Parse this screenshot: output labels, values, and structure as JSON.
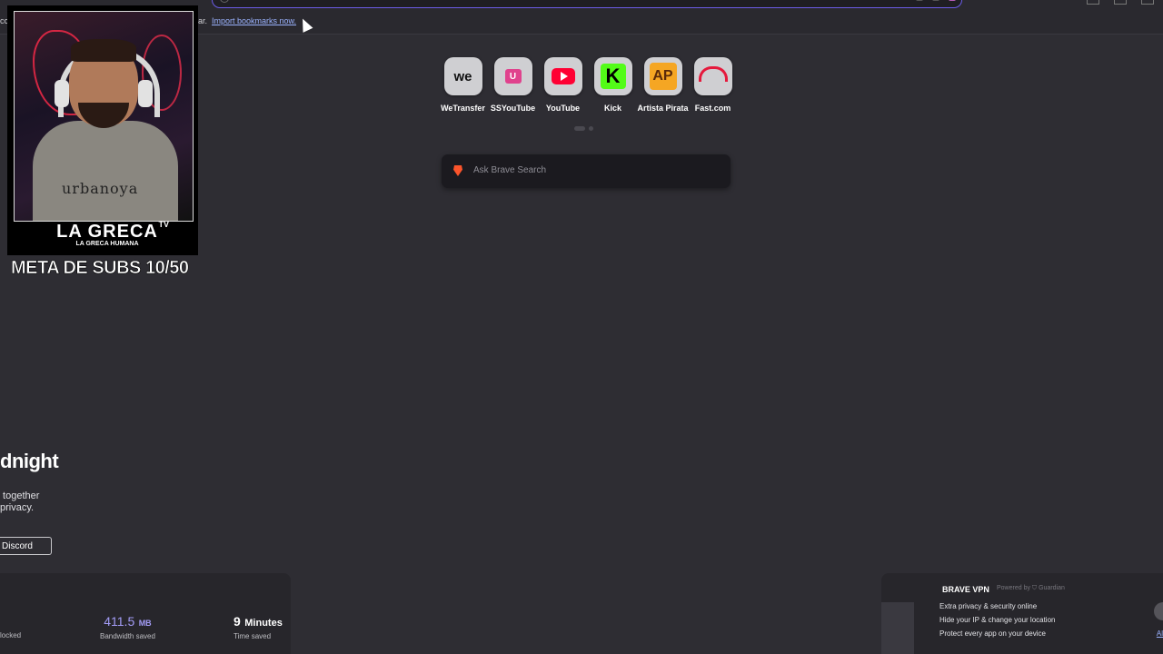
{
  "bookmarks_bar": {
    "left_fragment": "cc",
    "text_fragment": "ar.",
    "import_link": "Import bookmarks now."
  },
  "webcam_overlay": {
    "brand": "LA GRECA",
    "brand_tv": "TV",
    "brand_sub": "LA GRECA HUMANA",
    "shirt_text": "urbanoya",
    "subs_goal": "META DE SUBS 10/50"
  },
  "shortcuts": [
    {
      "label": "WeTransfer",
      "icon": "wetransfer-icon"
    },
    {
      "label": "SSYouTube",
      "icon": "ssyoutube-icon"
    },
    {
      "label": "YouTube",
      "icon": "youtube-icon"
    },
    {
      "label": "Kick",
      "icon": "kick-icon"
    },
    {
      "label": "Artista Pirata",
      "icon": "artista-pirata-icon"
    },
    {
      "label": "Fast.com",
      "icon": "fast-icon"
    }
  ],
  "shortcut_glyphs": {
    "wetransfer": "we",
    "ssyoutube": "U",
    "kick": "K",
    "artista_pirata": "AP"
  },
  "search": {
    "placeholder": "Ask Brave Search"
  },
  "promo_card": {
    "title_fragment": "dnight",
    "desc_fragment": " together\nprivacy.",
    "button_label": "Discord"
  },
  "stats": {
    "blocked_label": "locked",
    "bandwidth_value": "411.5",
    "bandwidth_unit": "MB",
    "bandwidth_label": "Bandwidth saved",
    "time_value": "9",
    "time_unit": "Minutes",
    "time_label": "Time saved"
  },
  "vpn_card": {
    "title": "BRAVE VPN",
    "powered_by": "Powered by ⛉ Guardian",
    "features": [
      "Extra privacy & security online",
      "Hide your IP & change your location",
      "Protect every app on your device"
    ],
    "link_fragment": "Al"
  },
  "colors": {
    "accent": "#6b5ce7",
    "stat_accent": "#a39cf6",
    "background": "#2e2d33"
  }
}
